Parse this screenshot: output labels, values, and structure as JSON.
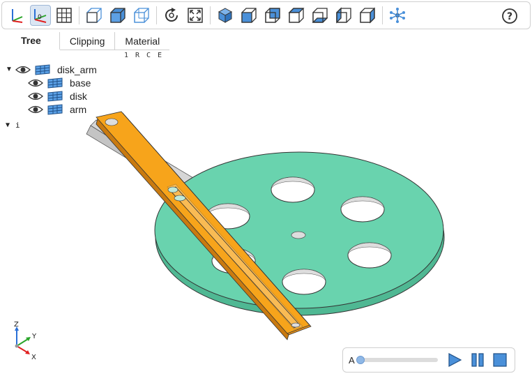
{
  "toolbar": {
    "buttons": [
      {
        "name": "axes-icon"
      },
      {
        "name": "axes-origin-icon",
        "active": true,
        "label": "0"
      },
      {
        "name": "grid-icon"
      },
      {
        "name": "transparent-icon"
      },
      {
        "name": "black-edges-icon"
      },
      {
        "name": "wireframe-icon"
      },
      {
        "name": "reset-view-icon"
      },
      {
        "name": "zoom-fit-icon"
      },
      {
        "name": "iso-view-icon"
      },
      {
        "name": "front-view-icon"
      },
      {
        "name": "rear-view-icon"
      },
      {
        "name": "top-view-icon"
      },
      {
        "name": "bottom-view-icon"
      },
      {
        "name": "left-view-icon"
      },
      {
        "name": "right-view-icon"
      },
      {
        "name": "explode-icon"
      }
    ],
    "help_label": "?"
  },
  "tabs": [
    {
      "label": "Tree",
      "active": true
    },
    {
      "label": "Clipping",
      "active": false
    },
    {
      "label": "Material",
      "active": false
    }
  ],
  "columns": [
    "1",
    "R",
    "C",
    "E"
  ],
  "tree": {
    "root": {
      "label": "disk_arm",
      "caret": "▼"
    },
    "children": [
      {
        "label": "base"
      },
      {
        "label": "disk"
      },
      {
        "label": "arm"
      }
    ],
    "second": {
      "label": "i",
      "caret": "▼"
    }
  },
  "triad": {
    "z": "Z",
    "y": "Y",
    "x": "X"
  },
  "animation": {
    "label": "A",
    "progress": 0
  },
  "colors": {
    "accent_blue": "#4a90d9",
    "disk_green": "#69d3ae",
    "arm_orange": "#f7a41b",
    "base_gray": "#dcdcdc"
  }
}
